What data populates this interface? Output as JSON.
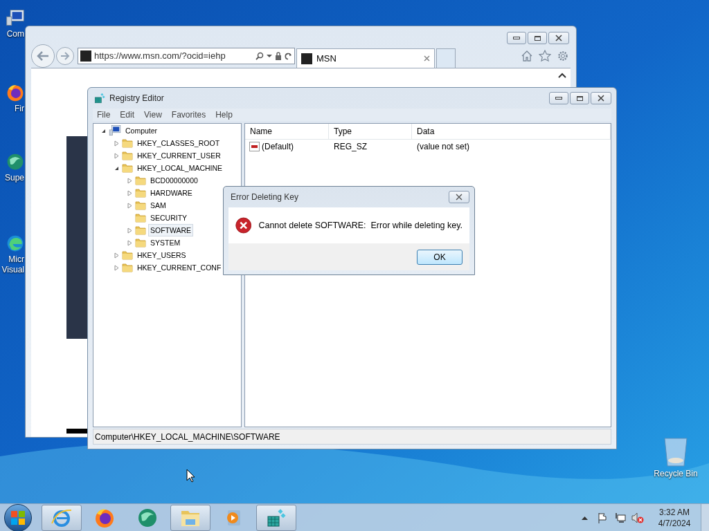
{
  "desktop_icons": [
    {
      "kind": "computer",
      "label_lines": [
        "Com"
      ]
    },
    {
      "kind": "firefox",
      "label_lines": [
        "Fir"
      ]
    },
    {
      "kind": "globe",
      "label_lines": [
        "Supe"
      ]
    },
    {
      "kind": "edge",
      "label_lines": [
        "Micr",
        "Visual"
      ]
    }
  ],
  "browser": {
    "address": "https://www.msn.com/?ocid=iehp",
    "tab": {
      "title": "MSN",
      "selected": true
    }
  },
  "registry_editor": {
    "title": "Registry Editor",
    "menu": [
      "File",
      "Edit",
      "View",
      "Favorites",
      "Help"
    ],
    "tree": {
      "label": "Computer",
      "kind": "computer",
      "expanded": true,
      "expandable": true,
      "selected": false,
      "children": [
        {
          "label": "HKEY_CLASSES_ROOT",
          "expanded": false,
          "expandable": true,
          "selected": false
        },
        {
          "label": "HKEY_CURRENT_USER",
          "expanded": false,
          "expandable": true,
          "selected": false
        },
        {
          "label": "HKEY_LOCAL_MACHINE",
          "expanded": true,
          "expandable": true,
          "selected": false,
          "children": [
            {
              "label": "BCD00000000",
              "expanded": false,
              "expandable": true,
              "selected": false
            },
            {
              "label": "HARDWARE",
              "expanded": false,
              "expandable": true,
              "selected": false
            },
            {
              "label": "SAM",
              "expanded": false,
              "expandable": true,
              "selected": false
            },
            {
              "label": "SECURITY",
              "expanded": false,
              "expandable": false,
              "selected": false
            },
            {
              "label": "SOFTWARE",
              "expanded": false,
              "expandable": true,
              "selected": true
            },
            {
              "label": "SYSTEM",
              "expanded": false,
              "expandable": true,
              "selected": false
            }
          ]
        },
        {
          "label": "HKEY_USERS",
          "expanded": false,
          "expandable": true,
          "selected": false
        },
        {
          "label": "HKEY_CURRENT_CONF",
          "expanded": false,
          "expandable": true,
          "selected": false
        }
      ]
    },
    "columns": [
      "Name",
      "Type",
      "Data"
    ],
    "rows": [
      {
        "name": "(Default)",
        "type": "REG_SZ",
        "data": "(value not set)"
      }
    ],
    "status": "Computer\\HKEY_LOCAL_MACHINE\\SOFTWARE"
  },
  "dialog": {
    "title": "Error Deleting Key",
    "message": "Cannot delete SOFTWARE:  Error while deleting key.",
    "button": "OK"
  },
  "recycle_bin": {
    "label": "Recycle Bin"
  },
  "taskbar": {
    "apps": [
      {
        "kind": "ie",
        "running": true
      },
      {
        "kind": "firefox",
        "running": false
      },
      {
        "kind": "globe",
        "running": false
      },
      {
        "kind": "explorer",
        "running": true
      },
      {
        "kind": "media",
        "running": false
      },
      {
        "kind": "regedit",
        "running": true
      }
    ],
    "time": "3:32 AM",
    "date": "4/7/2024"
  }
}
